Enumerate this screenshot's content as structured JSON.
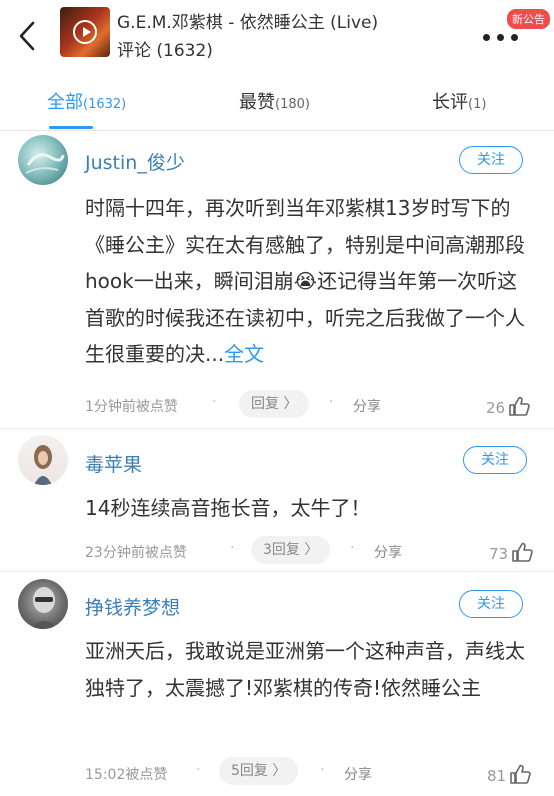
{
  "header": {
    "song_title": "G.E.M.邓紫棋 - 依然睡公主 (Live)",
    "comment_title": "评论 (1632)",
    "notice_badge": "新公告"
  },
  "tabs": [
    {
      "label": "全部",
      "count": "(1632)",
      "active": true
    },
    {
      "label": "最赞",
      "count": "(180)",
      "active": false
    },
    {
      "label": "长评",
      "count": "(1)",
      "active": false
    }
  ],
  "comments": [
    {
      "username": "Justin_俊少",
      "follow": "关注",
      "text": "时隔十四年，再次听到当年邓紫棋13岁时写下的《睡公主》实在太有感触了，特别是中间高潮那段hook一出来，瞬间泪崩😭还记得当年第一次听这首歌的时候我还在读初中，听完之后我做了一个人生很重要的决...",
      "full_text_link": "全文",
      "meta": "1分钟前被点赞",
      "reply": "回复",
      "share": "分享",
      "likes": "26"
    },
    {
      "username": "毒苹果",
      "follow": "关注",
      "text": "14秒连续高音拖长音，太牛了！",
      "meta": "23分钟前被点赞",
      "reply": "3回复",
      "share": "分享",
      "likes": "73"
    },
    {
      "username": "挣钱养梦想",
      "follow": "关注",
      "text": "亚洲天后，我敢说是亚洲第一个这种声音，声线太独特了，太震撼了!邓紫棋的传奇!依然睡公主",
      "meta": "15:02被点赞",
      "reply": "5回复",
      "share": "分享",
      "likes": "81"
    }
  ],
  "colors": {
    "accent": "#2f98f3",
    "username": "#3b7fb8",
    "badge": "#f04c4c"
  }
}
